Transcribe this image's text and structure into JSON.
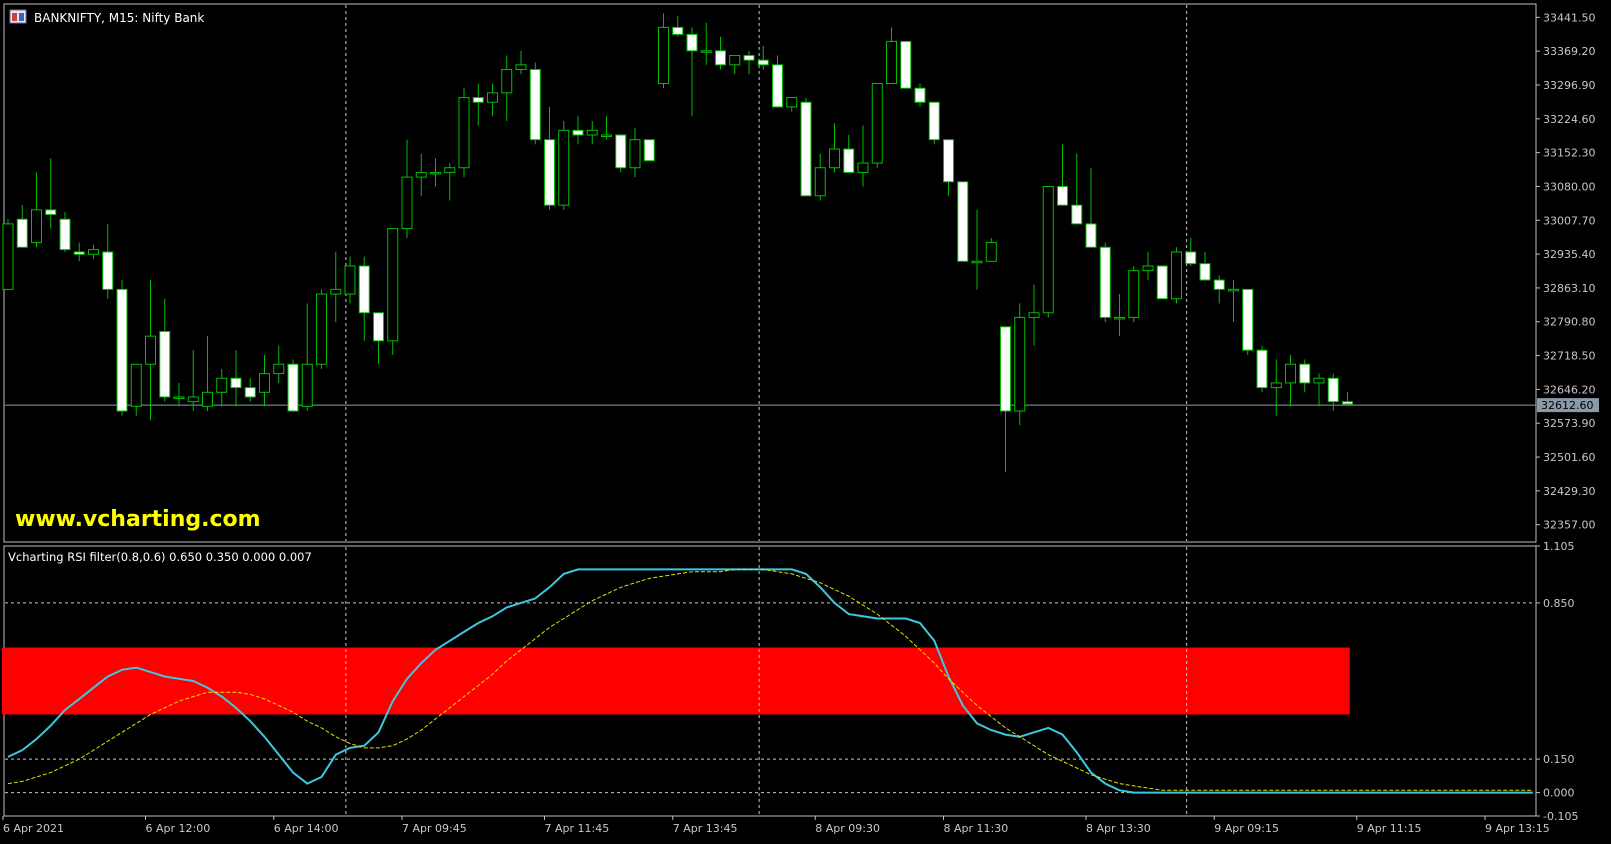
{
  "window": {
    "title": "BANKNIFTY, M15:  Nifty Bank",
    "watermark": "www.vcharting.com",
    "indicator_label": "Vcharting RSI filter(0.8,0.6) 0.650 0.350 0.000 0.007"
  },
  "colors": {
    "background": "#000000",
    "frame": "#c0c0c0",
    "grid": "#c8c8c8",
    "axis_text": "#c8c8c8",
    "bull_body": "#000000",
    "bear_body": "#ffffff",
    "wick": "#00c000",
    "price_line": "#8a9aa8",
    "price_tag_bg": "#8a9aa8",
    "price_tag_text": "#000000",
    "watermark": "#ffff00",
    "band": "#ff0000",
    "rsi_line": "#3ec8e0",
    "signal_line": "#e8e000"
  },
  "chart_data": [
    {
      "type": "candlestick",
      "symbol": "BANKNIFTY",
      "timeframe": "M15",
      "name": "Nifty Bank",
      "ylim": [
        32320,
        33470
      ],
      "y_ticks": [
        33441.5,
        33369.2,
        33296.9,
        33224.6,
        33152.3,
        33080.0,
        33007.7,
        32935.4,
        32863.1,
        32790.8,
        32718.5,
        32646.2,
        32573.9,
        32501.6,
        32429.3,
        32357.0
      ],
      "y_tick_labels": [
        "33441.50",
        "33369.20",
        "33296.90",
        "33224.60",
        "33152.30",
        "33080.00",
        "33007.70",
        "32935.40",
        "32863.10",
        "32790.80",
        "32718.50",
        "32646.20",
        "32573.90",
        "32501.60",
        "32429.30",
        "32357.00"
      ],
      "current_price": 32612.6,
      "current_price_label": "32612.60",
      "x_labels": [
        {
          "bar": 0,
          "label": "6 Apr 2021"
        },
        {
          "bar": 10,
          "label": "6 Apr 12:00"
        },
        {
          "bar": 19,
          "label": "6 Apr 14:00"
        },
        {
          "bar": 28,
          "label": "7 Apr 09:45"
        },
        {
          "bar": 38,
          "label": "7 Apr 11:45"
        },
        {
          "bar": 47,
          "label": "7 Apr 13:45"
        },
        {
          "bar": 57,
          "label": "8 Apr 09:30"
        },
        {
          "bar": 66,
          "label": "8 Apr 11:30"
        },
        {
          "bar": 76,
          "label": "8 Apr 13:30"
        },
        {
          "bar": 85,
          "label": "9 Apr 09:15"
        },
        {
          "bar": 95,
          "label": "9 Apr 11:15"
        },
        {
          "bar": 104,
          "label": "9 Apr 13:15"
        }
      ],
      "separators": [
        24,
        53,
        83
      ],
      "ohlc": [
        [
          32860,
          33010,
          32860,
          33000
        ],
        [
          33010,
          33040,
          32970,
          32950
        ],
        [
          32960,
          33110,
          32950,
          33030
        ],
        [
          33030,
          33140,
          32990,
          33020
        ],
        [
          33010,
          33025,
          32940,
          32945
        ],
        [
          32940,
          32960,
          32920,
          32935
        ],
        [
          32935,
          32955,
          32925,
          32945
        ],
        [
          32940,
          33000,
          32840,
          32860
        ],
        [
          32860,
          32880,
          32590,
          32600
        ],
        [
          32610,
          32700,
          32590,
          32700
        ],
        [
          32700,
          32880,
          32580,
          32760
        ],
        [
          32770,
          32840,
          32620,
          32630
        ],
        [
          32630,
          32660,
          32610,
          32630
        ],
        [
          32620,
          32730,
          32600,
          32630
        ],
        [
          32610,
          32760,
          32600,
          32640
        ],
        [
          32640,
          32690,
          32610,
          32670
        ],
        [
          32670,
          32730,
          32610,
          32650
        ],
        [
          32650,
          32670,
          32620,
          32630
        ],
        [
          32640,
          32720,
          32610,
          32680
        ],
        [
          32680,
          32740,
          32660,
          32700
        ],
        [
          32700,
          32710,
          32610,
          32600
        ],
        [
          32610,
          32830,
          32600,
          32700
        ],
        [
          32700,
          32860,
          32690,
          32850
        ],
        [
          32850,
          32940,
          32790,
          32860
        ],
        [
          32850,
          32930,
          32830,
          32910
        ],
        [
          32910,
          32930,
          32750,
          32810
        ],
        [
          32810,
          32800,
          32700,
          32750
        ],
        [
          32750,
          32950,
          32720,
          32990
        ],
        [
          32990,
          33180,
          32970,
          33100
        ],
        [
          33100,
          33150,
          33060,
          33110
        ],
        [
          33110,
          33140,
          33080,
          33110
        ],
        [
          33110,
          33130,
          33050,
          33120
        ],
        [
          33120,
          33290,
          33100,
          33270
        ],
        [
          33270,
          33300,
          33210,
          33260
        ],
        [
          33260,
          33300,
          33230,
          33280
        ],
        [
          33280,
          33360,
          33220,
          33330
        ],
        [
          33330,
          33370,
          33320,
          33340
        ],
        [
          33330,
          33345,
          33170,
          33180
        ],
        [
          33180,
          33250,
          33030,
          33040
        ],
        [
          33040,
          33220,
          33030,
          33200
        ],
        [
          33200,
          33230,
          33170,
          33190
        ],
        [
          33190,
          33220,
          33170,
          33200
        ],
        [
          33190,
          33230,
          33180,
          33190
        ],
        [
          33190,
          33170,
          33110,
          33120
        ],
        [
          33120,
          33205,
          33100,
          33180
        ],
        [
          33180,
          33170,
          33135,
          33135
        ],
        [
          33300,
          33450,
          33290,
          33420
        ],
        [
          33420,
          33445,
          33400,
          33405
        ],
        [
          33405,
          33420,
          33230,
          33370
        ],
        [
          33370,
          33430,
          33340,
          33370
        ],
        [
          33370,
          33400,
          33330,
          33340
        ],
        [
          33340,
          33360,
          33320,
          33360
        ],
        [
          33360,
          33370,
          33320,
          33350
        ],
        [
          33350,
          33380,
          33330,
          33340
        ],
        [
          33340,
          33360,
          33250,
          33250
        ],
        [
          33250,
          33270,
          33240,
          33270
        ],
        [
          33260,
          33270,
          33060,
          33060
        ],
        [
          33060,
          33150,
          33050,
          33120
        ],
        [
          33120,
          33215,
          33110,
          33160
        ],
        [
          33160,
          33190,
          33110,
          33110
        ],
        [
          33110,
          33210,
          33080,
          33130
        ],
        [
          33130,
          33295,
          33120,
          33300
        ],
        [
          33300,
          33420,
          33310,
          33390
        ],
        [
          33390,
          33390,
          33290,
          33290
        ],
        [
          33290,
          33300,
          33250,
          33260
        ],
        [
          33260,
          33250,
          33170,
          33180
        ],
        [
          33180,
          33180,
          33060,
          33090
        ],
        [
          33090,
          33090,
          32920,
          32920
        ],
        [
          32920,
          33030,
          32860,
          32920
        ],
        [
          32920,
          32970,
          32920,
          32960
        ],
        [
          32780,
          32780,
          32470,
          32600
        ],
        [
          32600,
          32830,
          32570,
          32800
        ],
        [
          32800,
          32870,
          32740,
          32810
        ],
        [
          32810,
          33060,
          32800,
          33080
        ],
        [
          33080,
          33170,
          33040,
          33040
        ],
        [
          33040,
          33150,
          33000,
          33000
        ],
        [
          33000,
          33120,
          32960,
          32950
        ],
        [
          32950,
          32960,
          32790,
          32800
        ],
        [
          32800,
          32850,
          32760,
          32800
        ],
        [
          32800,
          32910,
          32790,
          32900
        ],
        [
          32900,
          32940,
          32880,
          32910
        ],
        [
          32910,
          32900,
          32840,
          32840
        ],
        [
          32840,
          32950,
          32830,
          32940
        ],
        [
          32940,
          32970,
          32910,
          32915
        ],
        [
          32915,
          32940,
          32900,
          32880
        ],
        [
          32880,
          32890,
          32830,
          32860
        ],
        [
          32860,
          32880,
          32790,
          32860
        ],
        [
          32860,
          32860,
          32720,
          32730
        ],
        [
          32730,
          32740,
          32640,
          32650
        ],
        [
          32650,
          32710,
          32590,
          32660
        ],
        [
          32660,
          32720,
          32610,
          32700
        ],
        [
          32700,
          32710,
          32640,
          32660
        ],
        [
          32660,
          32680,
          32610,
          32670
        ],
        [
          32670,
          32680,
          32600,
          32620
        ],
        [
          32620,
          32640,
          32615,
          32615
        ]
      ]
    },
    {
      "type": "line",
      "name": "Vcharting RSI filter(0.8,0.6) 0.650 0.350 0.000 0.007",
      "ylim": [
        -0.105,
        1.105
      ],
      "y_ticks": [
        1.105,
        0.85,
        0.15,
        0.0,
        -0.105
      ],
      "y_tick_labels": [
        "1.105",
        "0.850",
        "0.150",
        "0.000",
        "-0.105"
      ],
      "grid_levels": [
        0.85,
        0.15,
        0.0
      ],
      "band": [
        0.35,
        0.65
      ],
      "series": [
        {
          "role": "rsi",
          "x": [
            0,
            1,
            2,
            3,
            4,
            5,
            6,
            7,
            8,
            9,
            10,
            11,
            12,
            13,
            14,
            15,
            16,
            17,
            18,
            19,
            20,
            21,
            22,
            23,
            24,
            25,
            26,
            27,
            28,
            29,
            30,
            31,
            32,
            33,
            34,
            35,
            36,
            37,
            38,
            39,
            40,
            41,
            42,
            43,
            44,
            45,
            46,
            47,
            48,
            49,
            50,
            51,
            52,
            53,
            54,
            55,
            56,
            57,
            58,
            59,
            60,
            61,
            62,
            63,
            64,
            65,
            66,
            67,
            68,
            69,
            70,
            71,
            72,
            73,
            74,
            75,
            76,
            77,
            78,
            79,
            80,
            81,
            82,
            83,
            84,
            85,
            86,
            87,
            88,
            89,
            90,
            91,
            92,
            93,
            94,
            95,
            96,
            97,
            98,
            99,
            100,
            101,
            102,
            103,
            104,
            105,
            106,
            107
          ],
          "y": [
            0.16,
            0.19,
            0.24,
            0.3,
            0.37,
            0.42,
            0.47,
            0.52,
            0.55,
            0.56,
            0.54,
            0.52,
            0.51,
            0.5,
            0.47,
            0.43,
            0.38,
            0.32,
            0.25,
            0.17,
            0.09,
            0.04,
            0.07,
            0.17,
            0.2,
            0.21,
            0.27,
            0.41,
            0.51,
            0.58,
            0.64,
            0.68,
            0.72,
            0.76,
            0.79,
            0.83,
            0.85,
            0.87,
            0.92,
            0.98,
            1.0,
            1.0,
            1.0,
            1.0,
            1.0,
            1.0,
            1.0,
            1.0,
            1.0,
            1.0,
            1.0,
            1.0,
            1.0,
            1.0,
            1.0,
            1.0,
            0.98,
            0.92,
            0.85,
            0.8,
            0.79,
            0.78,
            0.78,
            0.78,
            0.76,
            0.68,
            0.52,
            0.39,
            0.31,
            0.28,
            0.26,
            0.25,
            0.27,
            0.29,
            0.26,
            0.18,
            0.09,
            0.04,
            0.01,
            0.0,
            0.0,
            0.0,
            0.0,
            0.0,
            0.0,
            0.0,
            0.0,
            0.0,
            0.0,
            0.0,
            0.0,
            0.0,
            0.0,
            0.0,
            0.0,
            0.0,
            0.0,
            0.0,
            0.0,
            0.0,
            0.0,
            0.0,
            0.0,
            0.0,
            0.0,
            0.0,
            0.0,
            0.0
          ]
        },
        {
          "role": "signal",
          "x": [
            0,
            1,
            2,
            3,
            4,
            5,
            6,
            7,
            8,
            9,
            10,
            11,
            12,
            13,
            14,
            15,
            16,
            17,
            18,
            19,
            20,
            21,
            22,
            23,
            24,
            25,
            26,
            27,
            28,
            29,
            30,
            31,
            32,
            33,
            34,
            35,
            36,
            37,
            38,
            39,
            40,
            41,
            42,
            43,
            44,
            45,
            46,
            47,
            48,
            49,
            50,
            51,
            52,
            53,
            54,
            55,
            56,
            57,
            58,
            59,
            60,
            61,
            62,
            63,
            64,
            65,
            66,
            67,
            68,
            69,
            70,
            71,
            72,
            73,
            74,
            75,
            76,
            77,
            78,
            79,
            80,
            81,
            82,
            83,
            84,
            85,
            86,
            87,
            88,
            89,
            90,
            91,
            92,
            93,
            94,
            95,
            96,
            97,
            98,
            99,
            100,
            101,
            102,
            103,
            104,
            105,
            106,
            107
          ],
          "y": [
            0.04,
            0.05,
            0.07,
            0.09,
            0.12,
            0.15,
            0.19,
            0.23,
            0.27,
            0.31,
            0.35,
            0.38,
            0.41,
            0.43,
            0.45,
            0.45,
            0.45,
            0.44,
            0.42,
            0.39,
            0.36,
            0.32,
            0.29,
            0.25,
            0.22,
            0.2,
            0.2,
            0.21,
            0.24,
            0.28,
            0.33,
            0.38,
            0.43,
            0.48,
            0.53,
            0.59,
            0.64,
            0.69,
            0.74,
            0.78,
            0.82,
            0.86,
            0.89,
            0.92,
            0.94,
            0.96,
            0.97,
            0.98,
            0.99,
            0.99,
            0.99,
            1.0,
            1.0,
            1.0,
            0.99,
            0.98,
            0.96,
            0.94,
            0.91,
            0.88,
            0.84,
            0.8,
            0.75,
            0.7,
            0.64,
            0.58,
            0.51,
            0.45,
            0.39,
            0.34,
            0.29,
            0.25,
            0.21,
            0.17,
            0.14,
            0.11,
            0.08,
            0.06,
            0.04,
            0.03,
            0.02,
            0.01,
            0.01,
            0.01,
            0.01,
            0.01,
            0.01,
            0.01,
            0.01,
            0.01,
            0.01,
            0.01,
            0.01,
            0.01,
            0.01,
            0.01,
            0.01,
            0.01,
            0.01,
            0.01,
            0.01,
            0.01,
            0.01,
            0.01,
            0.01,
            0.01,
            0.01,
            0.01
          ]
        }
      ]
    }
  ]
}
